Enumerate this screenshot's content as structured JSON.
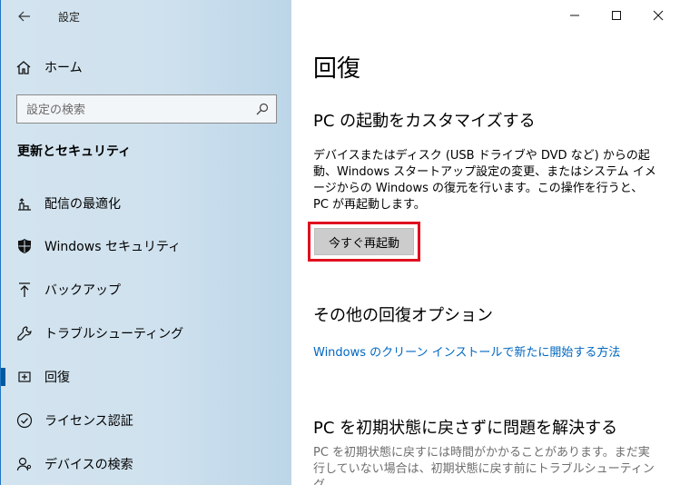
{
  "app": {
    "title": "設定"
  },
  "sidebar": {
    "home_label": "ホーム",
    "search_placeholder": "設定の検索",
    "section_heading": "更新とセキュリティ",
    "items": [
      {
        "label": "配信の最適化",
        "icon": "delivery-optimization-icon"
      },
      {
        "label": "Windows セキュリティ",
        "icon": "shield-icon"
      },
      {
        "label": "バックアップ",
        "icon": "backup-arrow-icon"
      },
      {
        "label": "トラブルシューティング",
        "icon": "wrench-icon"
      },
      {
        "label": "回復",
        "icon": "recovery-icon",
        "active": true
      },
      {
        "label": "ライセンス認証",
        "icon": "check-circle-icon"
      },
      {
        "label": "デバイスの検索",
        "icon": "person-location-icon"
      }
    ]
  },
  "main": {
    "title": "回復",
    "advanced_startup": {
      "heading": "PC の起動をカスタマイズする",
      "description": "デバイスまたはディスク (USB ドライブや DVD など) からの起動、Windows スタートアップ設定の変更、またはシステム イメージからの Windows の復元を行います。この操作を行うと、PC が再起動します。",
      "button_label": "今すぐ再起動"
    },
    "more_options": {
      "heading": "その他の回復オプション",
      "link": "Windows のクリーン インストールで新たに開始する方法"
    },
    "fix_without_reset": {
      "heading": "PC を初期状態に戻さずに問題を解決する",
      "description": "PC を初期状態に戻すには時間がかかることがあります。まだ実行していない場合は、初期状態に戻す前にトラブルシューティング"
    }
  },
  "colors": {
    "accent": "#0067c0",
    "highlight_border": "#e0101f",
    "active_bar": "#005a9e"
  }
}
